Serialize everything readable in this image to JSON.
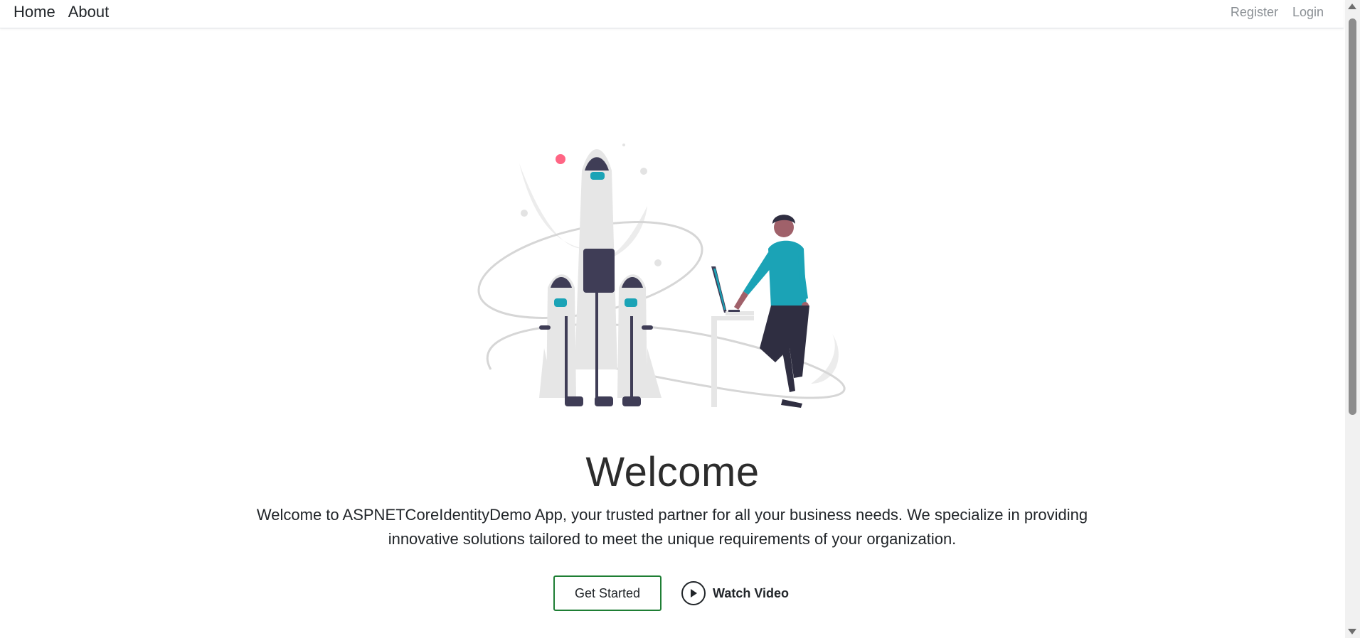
{
  "nav": {
    "left": [
      "Home",
      "About"
    ],
    "right": [
      "Register",
      "Login"
    ]
  },
  "hero": {
    "title": "Welcome",
    "text": "Welcome to ASPNETCoreIdentityDemo App, your trusted partner for all your business needs. We specialize in providing innovative solutions tailored to meet the unique requirements of your organization.",
    "primary_button": "Get Started",
    "secondary_button": "Watch Video",
    "secondary_icon": "play-circle-icon"
  },
  "colors": {
    "accent_teal": "#1ba3b6",
    "dark_navy": "#3f3d56",
    "rocket_gray": "#e6e6e6",
    "red_dot": "#ff6584",
    "button_border": "#1e7e34"
  }
}
